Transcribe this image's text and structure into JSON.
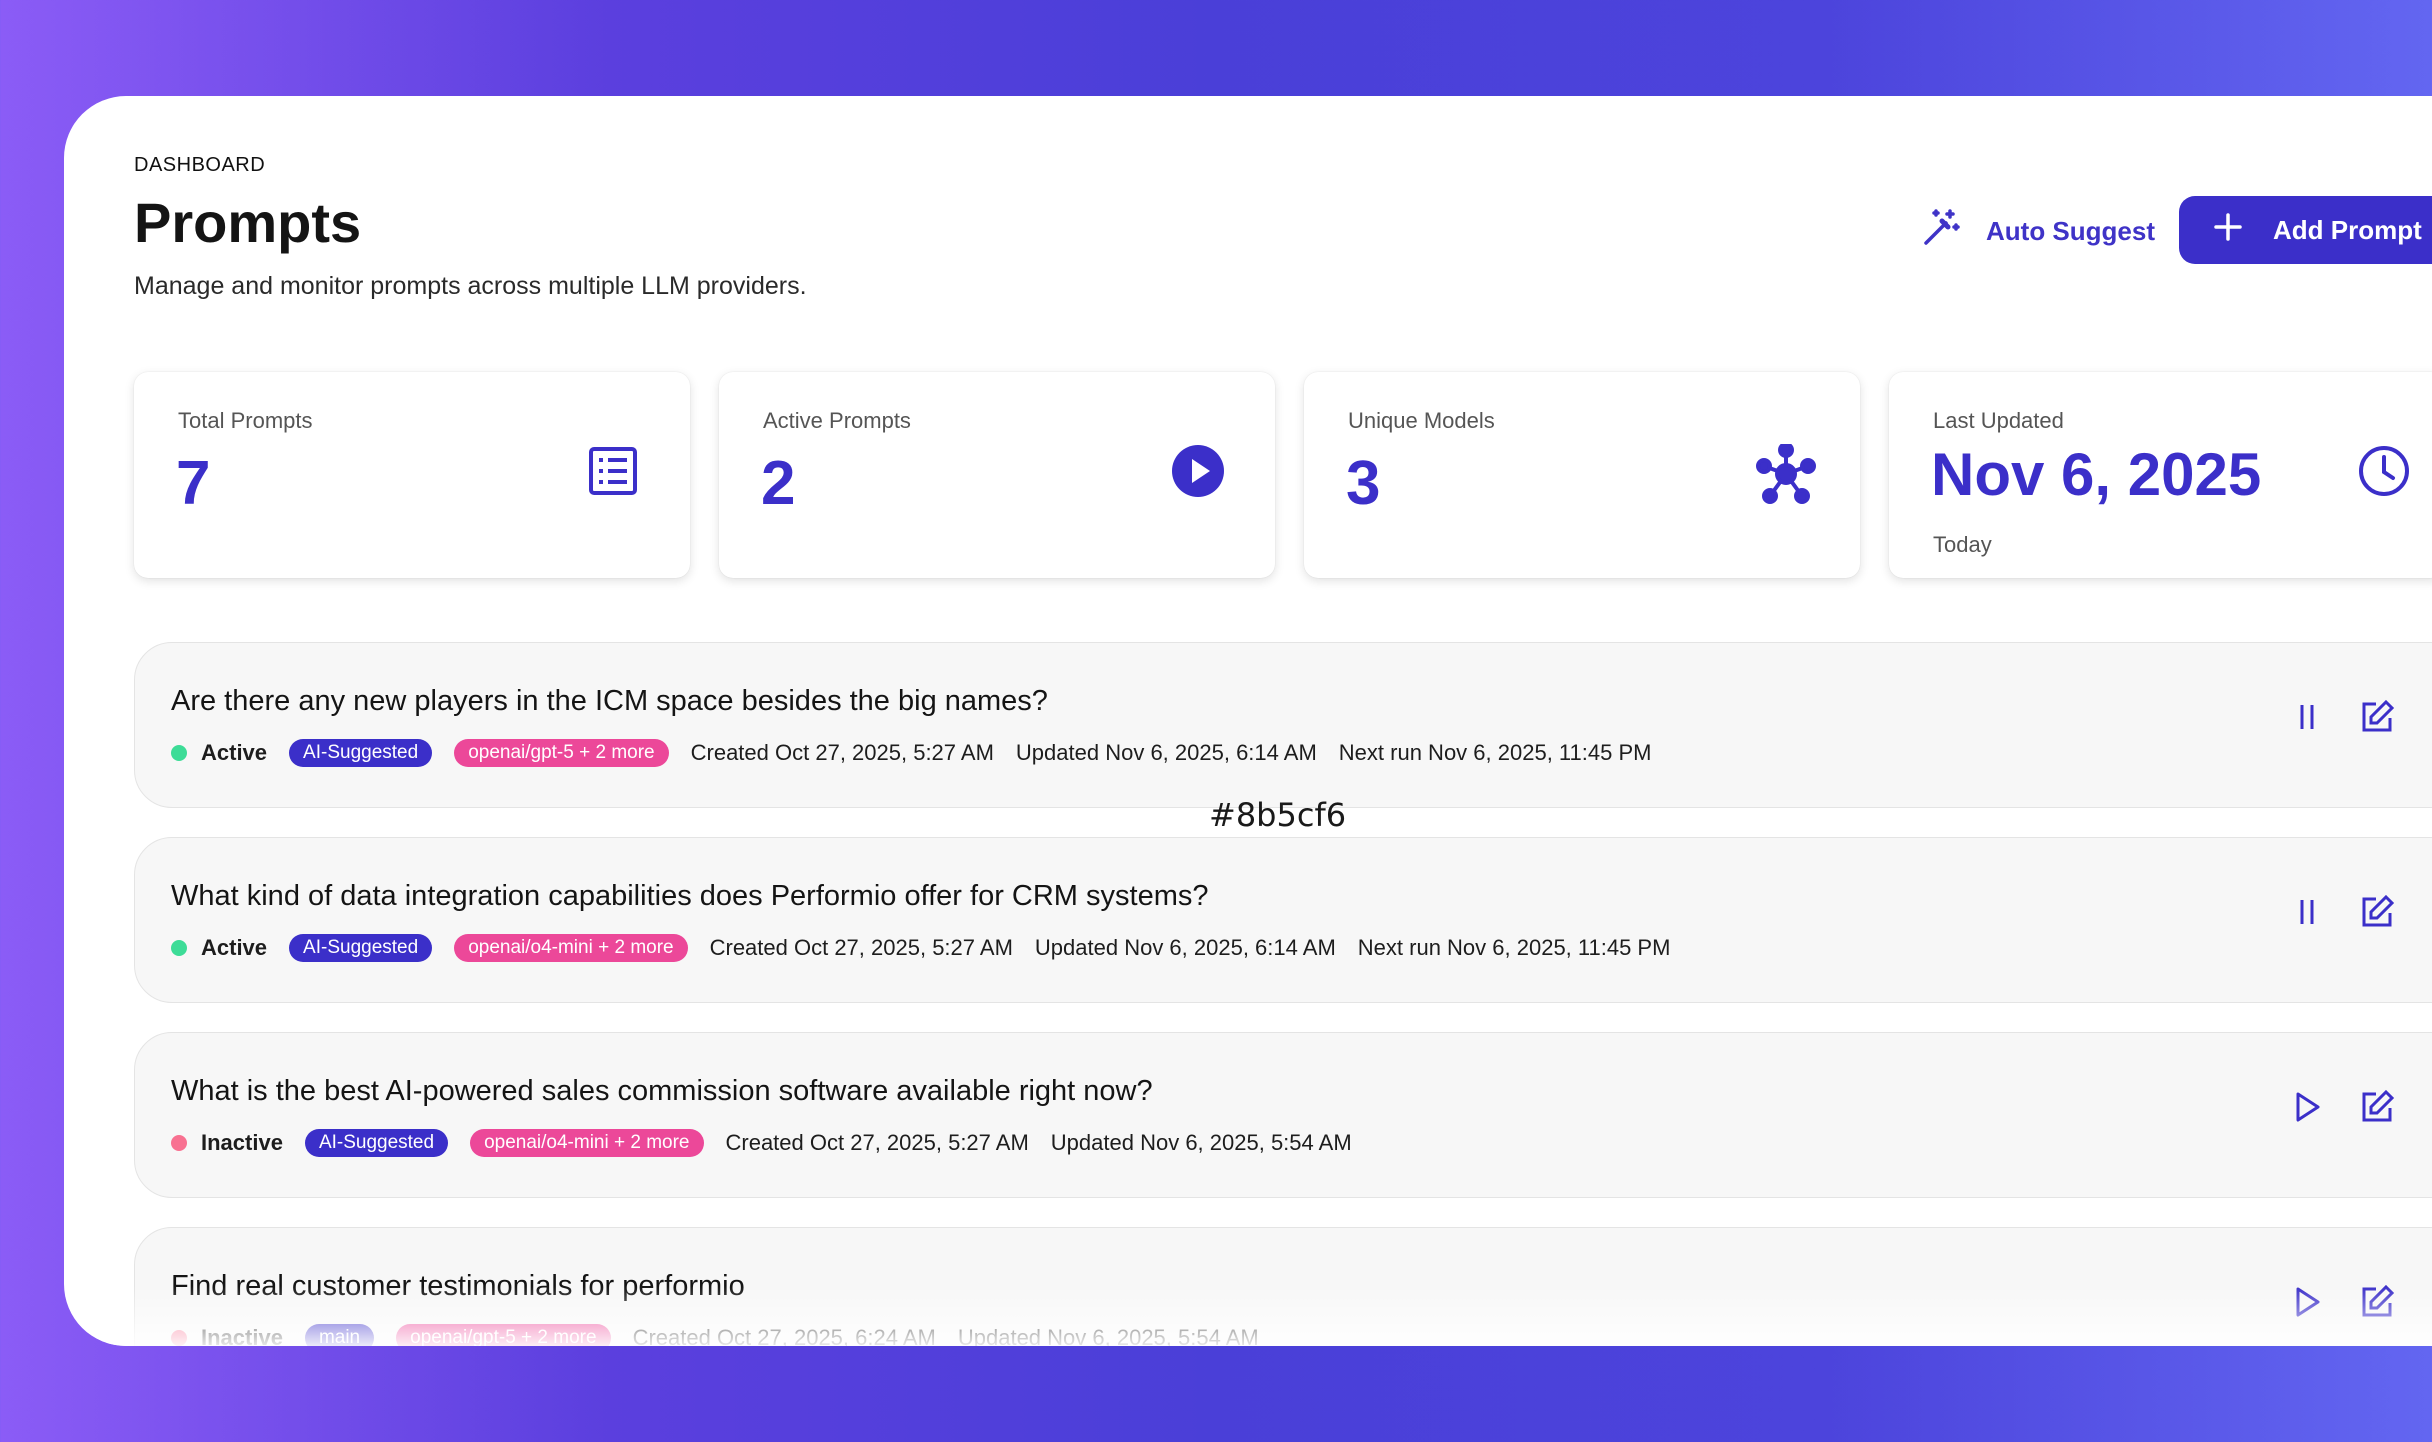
{
  "header": {
    "breadcrumb": "DASHBOARD",
    "title": "Prompts",
    "subtitle": "Manage and monitor prompts across multiple LLM providers.",
    "auto_suggest_label": "Auto Suggest",
    "add_prompt_label": "Add Prompt"
  },
  "stats": [
    {
      "label": "Total Prompts",
      "value": "7",
      "icon": "list-icon"
    },
    {
      "label": "Active Prompts",
      "value": "2",
      "icon": "play-circle-icon"
    },
    {
      "label": "Unique Models",
      "value": "3",
      "icon": "network-icon"
    },
    {
      "label": "Last Updated",
      "value": "Nov 6, 2025",
      "note": "Today",
      "icon": "clock-icon"
    }
  ],
  "overlay": "#8b5cf6",
  "prompts": [
    {
      "question": "Are there any new players in the ICM space besides the big names?",
      "status": "Active",
      "tag": "AI-Suggested",
      "models": "openai/gpt-5 + 2 more",
      "created": "Created Oct 27, 2025, 5:27 AM",
      "updated": "Updated Nov 6, 2025, 6:14 AM",
      "next_run": "Next run Nov 6, 2025, 11:45 PM",
      "toggle_icon": "pause-icon"
    },
    {
      "question": "What kind of data integration capabilities does Performio offer for CRM systems?",
      "status": "Active",
      "tag": "AI-Suggested",
      "models": "openai/o4-mini + 2 more",
      "created": "Created Oct 27, 2025, 5:27 AM",
      "updated": "Updated Nov 6, 2025, 6:14 AM",
      "next_run": "Next run Nov 6, 2025, 11:45 PM",
      "toggle_icon": "pause-icon"
    },
    {
      "question": "What is the best AI-powered sales commission software available right now?",
      "status": "Inactive",
      "tag": "AI-Suggested",
      "models": "openai/o4-mini + 2 more",
      "created": "Created Oct 27, 2025, 5:27 AM",
      "updated": "Updated Nov 6, 2025, 5:54 AM",
      "next_run": "",
      "toggle_icon": "play-icon"
    },
    {
      "question": "Find real customer testimonials for performio",
      "status": "Inactive",
      "tag": "main",
      "models": "openai/gpt-5 + 2 more",
      "created": "Created Oct 27, 2025, 6:24 AM",
      "updated": "Updated Nov 6, 2025, 5:54 AM",
      "next_run": "",
      "toggle_icon": "play-icon"
    }
  ],
  "colors": {
    "accent": "#3b2fc9",
    "active_dot": "#3ddc97",
    "inactive_dot": "#f87191",
    "model_chip": "#ec4899"
  }
}
